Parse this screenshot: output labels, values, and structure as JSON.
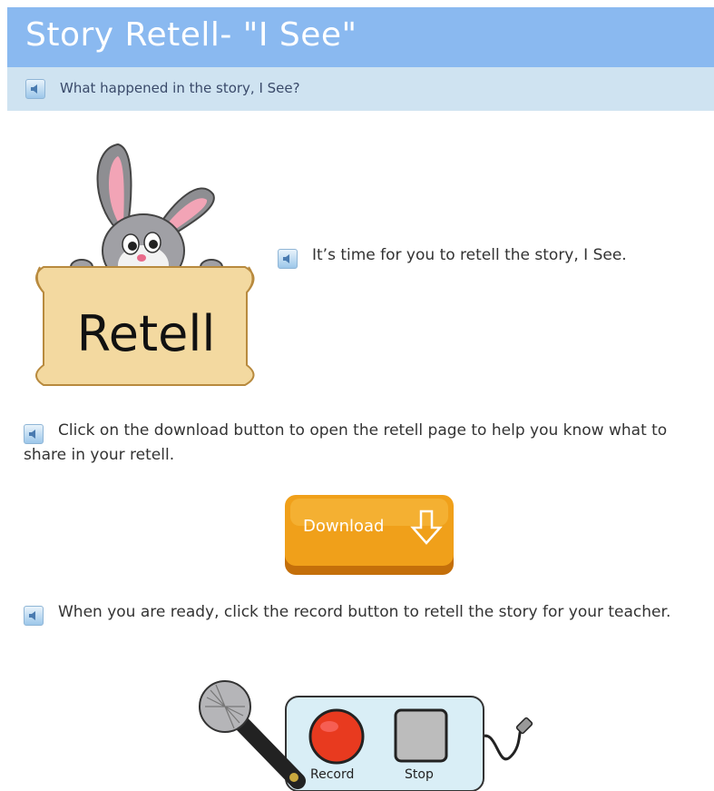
{
  "header": {
    "title": "Story Retell- \"I See\""
  },
  "subheader": {
    "text": "What happened in the story, I See?"
  },
  "retell_image": {
    "sign_text": "Retell"
  },
  "intro": {
    "text": "It’s time for you to retell the story, I See."
  },
  "download_section": {
    "text": "Click on the download button to open the retell page to help you know what to share in your retell.",
    "button_label": "Download"
  },
  "record_section": {
    "text": "When you are ready, click the record button to retell the story for your teacher.",
    "record_label": "Record",
    "stop_label": "Stop"
  },
  "colors": {
    "header_bg": "#8ab9f0",
    "subheader_bg": "#cfe3f1",
    "download_orange": "#f0a01a",
    "record_red": "#e83a1f"
  }
}
